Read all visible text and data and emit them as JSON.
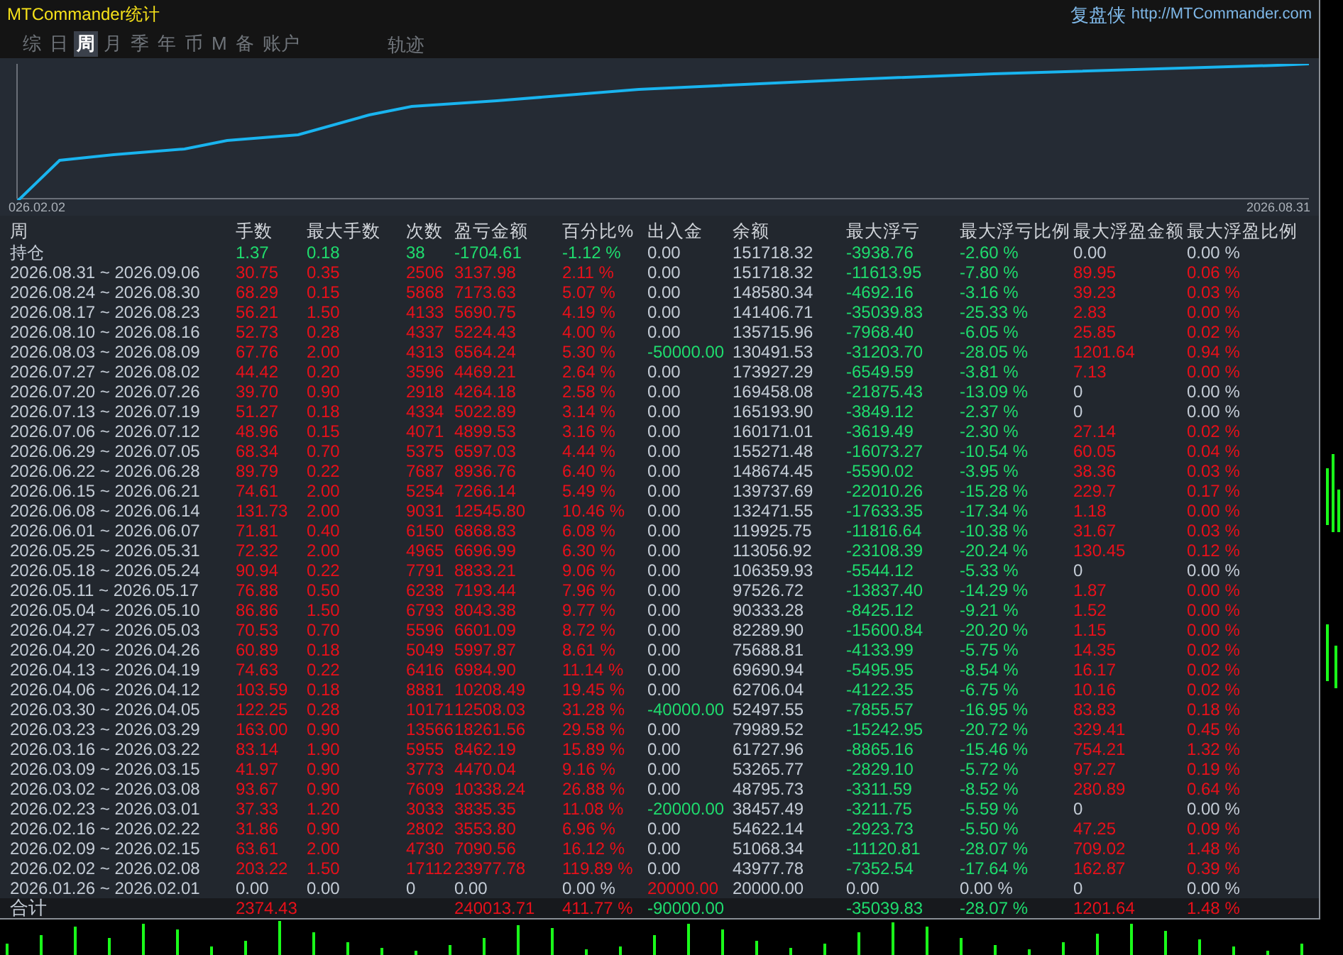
{
  "window": {
    "title": "MTCommander统计",
    "brand": "复盘侠",
    "url": "http://MTCommander.com"
  },
  "tabs": [
    {
      "label": "综",
      "selected": false
    },
    {
      "label": "日",
      "selected": false
    },
    {
      "label": "周",
      "selected": true
    },
    {
      "label": "月",
      "selected": false
    },
    {
      "label": "季",
      "selected": false
    },
    {
      "label": "年",
      "selected": false
    },
    {
      "label": "币",
      "selected": false
    },
    {
      "label": "M",
      "selected": false
    },
    {
      "label": "备",
      "selected": false
    },
    {
      "label": "账户",
      "selected": false
    }
  ],
  "trace_button": {
    "label": "轨迹"
  },
  "equity_chart": {
    "start_label": "026.02.02",
    "end_label": "2026.08.31"
  },
  "table": {
    "columns": [
      "周",
      "手数",
      "最大手数",
      "次数",
      "盈亏金额",
      "百分比%",
      "出入金",
      "余额",
      "最大浮亏",
      "最大浮亏比例",
      "最大浮盈金额",
      "最大浮盈比例"
    ],
    "rows": [
      {
        "cells": [
          {
            "text": "持仓",
            "kind": "flat"
          },
          {
            "text": "1.37",
            "kind": "down"
          },
          {
            "text": "0.18",
            "kind": "down"
          },
          {
            "text": "38",
            "kind": "down"
          },
          {
            "text": "-1704.61",
            "kind": "down"
          },
          {
            "text": "-1.12 %",
            "kind": "down"
          },
          {
            "text": "0.00",
            "kind": "flat"
          },
          {
            "text": "151718.32",
            "kind": "flat"
          },
          {
            "text": "-3938.76",
            "kind": "down"
          },
          {
            "text": "-2.60 %",
            "kind": "down"
          },
          {
            "text": "0.00",
            "kind": "flat"
          },
          {
            "text": "0.00 %",
            "kind": "flat"
          }
        ]
      },
      {
        "cells": [
          {
            "text": "2026.08.31 ~ 2026.09.06",
            "kind": "flat"
          },
          {
            "text": "30.75",
            "kind": "up"
          },
          {
            "text": "0.35",
            "kind": "up"
          },
          {
            "text": "2506",
            "kind": "up"
          },
          {
            "text": "3137.98",
            "kind": "up"
          },
          {
            "text": "2.11 %",
            "kind": "up"
          },
          {
            "text": "0.00",
            "kind": "flat"
          },
          {
            "text": "151718.32",
            "kind": "flat"
          },
          {
            "text": "-11613.95",
            "kind": "down"
          },
          {
            "text": "-7.80 %",
            "kind": "down"
          },
          {
            "text": "89.95",
            "kind": "up"
          },
          {
            "text": "0.06 %",
            "kind": "up"
          }
        ]
      },
      {
        "cells": [
          {
            "text": "2026.08.24 ~ 2026.08.30",
            "kind": "flat"
          },
          {
            "text": "68.29",
            "kind": "up"
          },
          {
            "text": "0.15",
            "kind": "up"
          },
          {
            "text": "5868",
            "kind": "up"
          },
          {
            "text": "7173.63",
            "kind": "up"
          },
          {
            "text": "5.07 %",
            "kind": "up"
          },
          {
            "text": "0.00",
            "kind": "flat"
          },
          {
            "text": "148580.34",
            "kind": "flat"
          },
          {
            "text": "-4692.16",
            "kind": "down"
          },
          {
            "text": "-3.16 %",
            "kind": "down"
          },
          {
            "text": "39.23",
            "kind": "up"
          },
          {
            "text": "0.03 %",
            "kind": "up"
          }
        ]
      },
      {
        "cells": [
          {
            "text": "2026.08.17 ~ 2026.08.23",
            "kind": "flat"
          },
          {
            "text": "56.21",
            "kind": "up"
          },
          {
            "text": "1.50",
            "kind": "up"
          },
          {
            "text": "4133",
            "kind": "up"
          },
          {
            "text": "5690.75",
            "kind": "up"
          },
          {
            "text": "4.19 %",
            "kind": "up"
          },
          {
            "text": "0.00",
            "kind": "flat"
          },
          {
            "text": "141406.71",
            "kind": "flat"
          },
          {
            "text": "-35039.83",
            "kind": "down"
          },
          {
            "text": "-25.33 %",
            "kind": "down"
          },
          {
            "text": "2.83",
            "kind": "up"
          },
          {
            "text": "0.00 %",
            "kind": "up"
          }
        ]
      },
      {
        "cells": [
          {
            "text": "2026.08.10 ~ 2026.08.16",
            "kind": "flat"
          },
          {
            "text": "52.73",
            "kind": "up"
          },
          {
            "text": "0.28",
            "kind": "up"
          },
          {
            "text": "4337",
            "kind": "up"
          },
          {
            "text": "5224.43",
            "kind": "up"
          },
          {
            "text": "4.00 %",
            "kind": "up"
          },
          {
            "text": "0.00",
            "kind": "flat"
          },
          {
            "text": "135715.96",
            "kind": "flat"
          },
          {
            "text": "-7968.40",
            "kind": "down"
          },
          {
            "text": "-6.05 %",
            "kind": "down"
          },
          {
            "text": "25.85",
            "kind": "up"
          },
          {
            "text": "0.02 %",
            "kind": "up"
          }
        ]
      },
      {
        "cells": [
          {
            "text": "2026.08.03 ~ 2026.08.09",
            "kind": "flat"
          },
          {
            "text": "67.76",
            "kind": "up"
          },
          {
            "text": "2.00",
            "kind": "up"
          },
          {
            "text": "4313",
            "kind": "up"
          },
          {
            "text": "6564.24",
            "kind": "up"
          },
          {
            "text": "5.30 %",
            "kind": "up"
          },
          {
            "text": "-50000.00",
            "kind": "down"
          },
          {
            "text": "130491.53",
            "kind": "flat"
          },
          {
            "text": "-31203.70",
            "kind": "down"
          },
          {
            "text": "-28.05 %",
            "kind": "down"
          },
          {
            "text": "1201.64",
            "kind": "up"
          },
          {
            "text": "0.94 %",
            "kind": "up"
          }
        ]
      },
      {
        "cells": [
          {
            "text": "2026.07.27 ~ 2026.08.02",
            "kind": "flat"
          },
          {
            "text": "44.42",
            "kind": "up"
          },
          {
            "text": "0.20",
            "kind": "up"
          },
          {
            "text": "3596",
            "kind": "up"
          },
          {
            "text": "4469.21",
            "kind": "up"
          },
          {
            "text": "2.64 %",
            "kind": "up"
          },
          {
            "text": "0.00",
            "kind": "flat"
          },
          {
            "text": "173927.29",
            "kind": "flat"
          },
          {
            "text": "-6549.59",
            "kind": "down"
          },
          {
            "text": "-3.81 %",
            "kind": "down"
          },
          {
            "text": "7.13",
            "kind": "up"
          },
          {
            "text": "0.00 %",
            "kind": "up"
          }
        ]
      },
      {
        "cells": [
          {
            "text": "2026.07.20 ~ 2026.07.26",
            "kind": "flat"
          },
          {
            "text": "39.70",
            "kind": "up"
          },
          {
            "text": "0.90",
            "kind": "up"
          },
          {
            "text": "2918",
            "kind": "up"
          },
          {
            "text": "4264.18",
            "kind": "up"
          },
          {
            "text": "2.58 %",
            "kind": "up"
          },
          {
            "text": "0.00",
            "kind": "flat"
          },
          {
            "text": "169458.08",
            "kind": "flat"
          },
          {
            "text": "-21875.43",
            "kind": "down"
          },
          {
            "text": "-13.09 %",
            "kind": "down"
          },
          {
            "text": "0",
            "kind": "flat"
          },
          {
            "text": "0.00 %",
            "kind": "flat"
          }
        ]
      },
      {
        "cells": [
          {
            "text": "2026.07.13 ~ 2026.07.19",
            "kind": "flat"
          },
          {
            "text": "51.27",
            "kind": "up"
          },
          {
            "text": "0.18",
            "kind": "up"
          },
          {
            "text": "4334",
            "kind": "up"
          },
          {
            "text": "5022.89",
            "kind": "up"
          },
          {
            "text": "3.14 %",
            "kind": "up"
          },
          {
            "text": "0.00",
            "kind": "flat"
          },
          {
            "text": "165193.90",
            "kind": "flat"
          },
          {
            "text": "-3849.12",
            "kind": "down"
          },
          {
            "text": "-2.37 %",
            "kind": "down"
          },
          {
            "text": "0",
            "kind": "flat"
          },
          {
            "text": "0.00 %",
            "kind": "flat"
          }
        ]
      },
      {
        "cells": [
          {
            "text": "2026.07.06 ~ 2026.07.12",
            "kind": "flat"
          },
          {
            "text": "48.96",
            "kind": "up"
          },
          {
            "text": "0.15",
            "kind": "up"
          },
          {
            "text": "4071",
            "kind": "up"
          },
          {
            "text": "4899.53",
            "kind": "up"
          },
          {
            "text": "3.16 %",
            "kind": "up"
          },
          {
            "text": "0.00",
            "kind": "flat"
          },
          {
            "text": "160171.01",
            "kind": "flat"
          },
          {
            "text": "-3619.49",
            "kind": "down"
          },
          {
            "text": "-2.30 %",
            "kind": "down"
          },
          {
            "text": "27.14",
            "kind": "up"
          },
          {
            "text": "0.02 %",
            "kind": "up"
          }
        ]
      },
      {
        "cells": [
          {
            "text": "2026.06.29 ~ 2026.07.05",
            "kind": "flat"
          },
          {
            "text": "68.34",
            "kind": "up"
          },
          {
            "text": "0.70",
            "kind": "up"
          },
          {
            "text": "5375",
            "kind": "up"
          },
          {
            "text": "6597.03",
            "kind": "up"
          },
          {
            "text": "4.44 %",
            "kind": "up"
          },
          {
            "text": "0.00",
            "kind": "flat"
          },
          {
            "text": "155271.48",
            "kind": "flat"
          },
          {
            "text": "-16073.27",
            "kind": "down"
          },
          {
            "text": "-10.54 %",
            "kind": "down"
          },
          {
            "text": "60.05",
            "kind": "up"
          },
          {
            "text": "0.04 %",
            "kind": "up"
          }
        ]
      },
      {
        "cells": [
          {
            "text": "2026.06.22 ~ 2026.06.28",
            "kind": "flat"
          },
          {
            "text": "89.79",
            "kind": "up"
          },
          {
            "text": "0.22",
            "kind": "up"
          },
          {
            "text": "7687",
            "kind": "up"
          },
          {
            "text": "8936.76",
            "kind": "up"
          },
          {
            "text": "6.40 %",
            "kind": "up"
          },
          {
            "text": "0.00",
            "kind": "flat"
          },
          {
            "text": "148674.45",
            "kind": "flat"
          },
          {
            "text": "-5590.02",
            "kind": "down"
          },
          {
            "text": "-3.95 %",
            "kind": "down"
          },
          {
            "text": "38.36",
            "kind": "up"
          },
          {
            "text": "0.03 %",
            "kind": "up"
          }
        ]
      },
      {
        "cells": [
          {
            "text": "2026.06.15 ~ 2026.06.21",
            "kind": "flat"
          },
          {
            "text": "74.61",
            "kind": "up"
          },
          {
            "text": "2.00",
            "kind": "up"
          },
          {
            "text": "5254",
            "kind": "up"
          },
          {
            "text": "7266.14",
            "kind": "up"
          },
          {
            "text": "5.49 %",
            "kind": "up"
          },
          {
            "text": "0.00",
            "kind": "flat"
          },
          {
            "text": "139737.69",
            "kind": "flat"
          },
          {
            "text": "-22010.26",
            "kind": "down"
          },
          {
            "text": "-15.28 %",
            "kind": "down"
          },
          {
            "text": "229.7",
            "kind": "up"
          },
          {
            "text": "0.17 %",
            "kind": "up"
          }
        ]
      },
      {
        "cells": [
          {
            "text": "2026.06.08 ~ 2026.06.14",
            "kind": "flat"
          },
          {
            "text": "131.73",
            "kind": "up"
          },
          {
            "text": "2.00",
            "kind": "up"
          },
          {
            "text": "9031",
            "kind": "up"
          },
          {
            "text": "12545.80",
            "kind": "up"
          },
          {
            "text": "10.46 %",
            "kind": "up"
          },
          {
            "text": "0.00",
            "kind": "flat"
          },
          {
            "text": "132471.55",
            "kind": "flat"
          },
          {
            "text": "-17633.35",
            "kind": "down"
          },
          {
            "text": "-17.34 %",
            "kind": "down"
          },
          {
            "text": "1.18",
            "kind": "up"
          },
          {
            "text": "0.00 %",
            "kind": "up"
          }
        ]
      },
      {
        "cells": [
          {
            "text": "2026.06.01 ~ 2026.06.07",
            "kind": "flat"
          },
          {
            "text": "71.81",
            "kind": "up"
          },
          {
            "text": "0.40",
            "kind": "up"
          },
          {
            "text": "6150",
            "kind": "up"
          },
          {
            "text": "6868.83",
            "kind": "up"
          },
          {
            "text": "6.08 %",
            "kind": "up"
          },
          {
            "text": "0.00",
            "kind": "flat"
          },
          {
            "text": "119925.75",
            "kind": "flat"
          },
          {
            "text": "-11816.64",
            "kind": "down"
          },
          {
            "text": "-10.38 %",
            "kind": "down"
          },
          {
            "text": "31.67",
            "kind": "up"
          },
          {
            "text": "0.03 %",
            "kind": "up"
          }
        ]
      },
      {
        "cells": [
          {
            "text": "2026.05.25 ~ 2026.05.31",
            "kind": "flat"
          },
          {
            "text": "72.32",
            "kind": "up"
          },
          {
            "text": "2.00",
            "kind": "up"
          },
          {
            "text": "4965",
            "kind": "up"
          },
          {
            "text": "6696.99",
            "kind": "up"
          },
          {
            "text": "6.30 %",
            "kind": "up"
          },
          {
            "text": "0.00",
            "kind": "flat"
          },
          {
            "text": "113056.92",
            "kind": "flat"
          },
          {
            "text": "-23108.39",
            "kind": "down"
          },
          {
            "text": "-20.24 %",
            "kind": "down"
          },
          {
            "text": "130.45",
            "kind": "up"
          },
          {
            "text": "0.12 %",
            "kind": "up"
          }
        ]
      },
      {
        "cells": [
          {
            "text": "2026.05.18 ~ 2026.05.24",
            "kind": "flat"
          },
          {
            "text": "90.94",
            "kind": "up"
          },
          {
            "text": "0.22",
            "kind": "up"
          },
          {
            "text": "7791",
            "kind": "up"
          },
          {
            "text": "8833.21",
            "kind": "up"
          },
          {
            "text": "9.06 %",
            "kind": "up"
          },
          {
            "text": "0.00",
            "kind": "flat"
          },
          {
            "text": "106359.93",
            "kind": "flat"
          },
          {
            "text": "-5544.12",
            "kind": "down"
          },
          {
            "text": "-5.33 %",
            "kind": "down"
          },
          {
            "text": "0",
            "kind": "flat"
          },
          {
            "text": "0.00 %",
            "kind": "flat"
          }
        ]
      },
      {
        "cells": [
          {
            "text": "2026.05.11 ~ 2026.05.17",
            "kind": "flat"
          },
          {
            "text": "76.88",
            "kind": "up"
          },
          {
            "text": "0.50",
            "kind": "up"
          },
          {
            "text": "6238",
            "kind": "up"
          },
          {
            "text": "7193.44",
            "kind": "up"
          },
          {
            "text": "7.96 %",
            "kind": "up"
          },
          {
            "text": "0.00",
            "kind": "flat"
          },
          {
            "text": "97526.72",
            "kind": "flat"
          },
          {
            "text": "-13837.40",
            "kind": "down"
          },
          {
            "text": "-14.29 %",
            "kind": "down"
          },
          {
            "text": "1.87",
            "kind": "up"
          },
          {
            "text": "0.00 %",
            "kind": "up"
          }
        ]
      },
      {
        "cells": [
          {
            "text": "2026.05.04 ~ 2026.05.10",
            "kind": "flat"
          },
          {
            "text": "86.86",
            "kind": "up"
          },
          {
            "text": "1.50",
            "kind": "up"
          },
          {
            "text": "6793",
            "kind": "up"
          },
          {
            "text": "8043.38",
            "kind": "up"
          },
          {
            "text": "9.77 %",
            "kind": "up"
          },
          {
            "text": "0.00",
            "kind": "flat"
          },
          {
            "text": "90333.28",
            "kind": "flat"
          },
          {
            "text": "-8425.12",
            "kind": "down"
          },
          {
            "text": "-9.21 %",
            "kind": "down"
          },
          {
            "text": "1.52",
            "kind": "up"
          },
          {
            "text": "0.00 %",
            "kind": "up"
          }
        ]
      },
      {
        "cells": [
          {
            "text": "2026.04.27 ~ 2026.05.03",
            "kind": "flat"
          },
          {
            "text": "70.53",
            "kind": "up"
          },
          {
            "text": "0.70",
            "kind": "up"
          },
          {
            "text": "5596",
            "kind": "up"
          },
          {
            "text": "6601.09",
            "kind": "up"
          },
          {
            "text": "8.72 %",
            "kind": "up"
          },
          {
            "text": "0.00",
            "kind": "flat"
          },
          {
            "text": "82289.90",
            "kind": "flat"
          },
          {
            "text": "-15600.84",
            "kind": "down"
          },
          {
            "text": "-20.20 %",
            "kind": "down"
          },
          {
            "text": "1.15",
            "kind": "up"
          },
          {
            "text": "0.00 %",
            "kind": "up"
          }
        ]
      },
      {
        "cells": [
          {
            "text": "2026.04.20 ~ 2026.04.26",
            "kind": "flat"
          },
          {
            "text": "60.89",
            "kind": "up"
          },
          {
            "text": "0.18",
            "kind": "up"
          },
          {
            "text": "5049",
            "kind": "up"
          },
          {
            "text": "5997.87",
            "kind": "up"
          },
          {
            "text": "8.61 %",
            "kind": "up"
          },
          {
            "text": "0.00",
            "kind": "flat"
          },
          {
            "text": "75688.81",
            "kind": "flat"
          },
          {
            "text": "-4133.99",
            "kind": "down"
          },
          {
            "text": "-5.75 %",
            "kind": "down"
          },
          {
            "text": "14.35",
            "kind": "up"
          },
          {
            "text": "0.02 %",
            "kind": "up"
          }
        ]
      },
      {
        "cells": [
          {
            "text": "2026.04.13 ~ 2026.04.19",
            "kind": "flat"
          },
          {
            "text": "74.63",
            "kind": "up"
          },
          {
            "text": "0.22",
            "kind": "up"
          },
          {
            "text": "6416",
            "kind": "up"
          },
          {
            "text": "6984.90",
            "kind": "up"
          },
          {
            "text": "11.14 %",
            "kind": "up"
          },
          {
            "text": "0.00",
            "kind": "flat"
          },
          {
            "text": "69690.94",
            "kind": "flat"
          },
          {
            "text": "-5495.95",
            "kind": "down"
          },
          {
            "text": "-8.54 %",
            "kind": "down"
          },
          {
            "text": "16.17",
            "kind": "up"
          },
          {
            "text": "0.02 %",
            "kind": "up"
          }
        ]
      },
      {
        "cells": [
          {
            "text": "2026.04.06 ~ 2026.04.12",
            "kind": "flat"
          },
          {
            "text": "103.59",
            "kind": "up"
          },
          {
            "text": "0.18",
            "kind": "up"
          },
          {
            "text": "8881",
            "kind": "up"
          },
          {
            "text": "10208.49",
            "kind": "up"
          },
          {
            "text": "19.45 %",
            "kind": "up"
          },
          {
            "text": "0.00",
            "kind": "flat"
          },
          {
            "text": "62706.04",
            "kind": "flat"
          },
          {
            "text": "-4122.35",
            "kind": "down"
          },
          {
            "text": "-6.75 %",
            "kind": "down"
          },
          {
            "text": "10.16",
            "kind": "up"
          },
          {
            "text": "0.02 %",
            "kind": "up"
          }
        ]
      },
      {
        "cells": [
          {
            "text": "2026.03.30 ~ 2026.04.05",
            "kind": "flat"
          },
          {
            "text": "122.25",
            "kind": "up"
          },
          {
            "text": "0.28",
            "kind": "up"
          },
          {
            "text": "10171",
            "kind": "up"
          },
          {
            "text": "12508.03",
            "kind": "up"
          },
          {
            "text": "31.28 %",
            "kind": "up"
          },
          {
            "text": "-40000.00",
            "kind": "down"
          },
          {
            "text": "52497.55",
            "kind": "flat"
          },
          {
            "text": "-7855.57",
            "kind": "down"
          },
          {
            "text": "-16.95 %",
            "kind": "down"
          },
          {
            "text": "83.83",
            "kind": "up"
          },
          {
            "text": "0.18 %",
            "kind": "up"
          }
        ]
      },
      {
        "cells": [
          {
            "text": "2026.03.23 ~ 2026.03.29",
            "kind": "flat"
          },
          {
            "text": "163.00",
            "kind": "up"
          },
          {
            "text": "0.90",
            "kind": "up"
          },
          {
            "text": "13566",
            "kind": "up"
          },
          {
            "text": "18261.56",
            "kind": "up"
          },
          {
            "text": "29.58 %",
            "kind": "up"
          },
          {
            "text": "0.00",
            "kind": "flat"
          },
          {
            "text": "79989.52",
            "kind": "flat"
          },
          {
            "text": "-15242.95",
            "kind": "down"
          },
          {
            "text": "-20.72 %",
            "kind": "down"
          },
          {
            "text": "329.41",
            "kind": "up"
          },
          {
            "text": "0.45 %",
            "kind": "up"
          }
        ]
      },
      {
        "cells": [
          {
            "text": "2026.03.16 ~ 2026.03.22",
            "kind": "flat"
          },
          {
            "text": "83.14",
            "kind": "up"
          },
          {
            "text": "1.90",
            "kind": "up"
          },
          {
            "text": "5955",
            "kind": "up"
          },
          {
            "text": "8462.19",
            "kind": "up"
          },
          {
            "text": "15.89 %",
            "kind": "up"
          },
          {
            "text": "0.00",
            "kind": "flat"
          },
          {
            "text": "61727.96",
            "kind": "flat"
          },
          {
            "text": "-8865.16",
            "kind": "down"
          },
          {
            "text": "-15.46 %",
            "kind": "down"
          },
          {
            "text": "754.21",
            "kind": "up"
          },
          {
            "text": "1.32 %",
            "kind": "up"
          }
        ]
      },
      {
        "cells": [
          {
            "text": "2026.03.09 ~ 2026.03.15",
            "kind": "flat"
          },
          {
            "text": "41.97",
            "kind": "up"
          },
          {
            "text": "0.90",
            "kind": "up"
          },
          {
            "text": "3773",
            "kind": "up"
          },
          {
            "text": "4470.04",
            "kind": "up"
          },
          {
            "text": "9.16 %",
            "kind": "up"
          },
          {
            "text": "0.00",
            "kind": "flat"
          },
          {
            "text": "53265.77",
            "kind": "flat"
          },
          {
            "text": "-2829.10",
            "kind": "down"
          },
          {
            "text": "-5.72 %",
            "kind": "down"
          },
          {
            "text": "97.27",
            "kind": "up"
          },
          {
            "text": "0.19 %",
            "kind": "up"
          }
        ]
      },
      {
        "cells": [
          {
            "text": "2026.03.02 ~ 2026.03.08",
            "kind": "flat"
          },
          {
            "text": "93.67",
            "kind": "up"
          },
          {
            "text": "0.90",
            "kind": "up"
          },
          {
            "text": "7609",
            "kind": "up"
          },
          {
            "text": "10338.24",
            "kind": "up"
          },
          {
            "text": "26.88 %",
            "kind": "up"
          },
          {
            "text": "0.00",
            "kind": "flat"
          },
          {
            "text": "48795.73",
            "kind": "flat"
          },
          {
            "text": "-3311.59",
            "kind": "down"
          },
          {
            "text": "-8.52 %",
            "kind": "down"
          },
          {
            "text": "280.89",
            "kind": "up"
          },
          {
            "text": "0.64 %",
            "kind": "up"
          }
        ]
      },
      {
        "cells": [
          {
            "text": "2026.02.23 ~ 2026.03.01",
            "kind": "flat"
          },
          {
            "text": "37.33",
            "kind": "up"
          },
          {
            "text": "1.20",
            "kind": "up"
          },
          {
            "text": "3033",
            "kind": "up"
          },
          {
            "text": "3835.35",
            "kind": "up"
          },
          {
            "text": "11.08 %",
            "kind": "up"
          },
          {
            "text": "-20000.00",
            "kind": "down"
          },
          {
            "text": "38457.49",
            "kind": "flat"
          },
          {
            "text": "-3211.75",
            "kind": "down"
          },
          {
            "text": "-5.59 %",
            "kind": "down"
          },
          {
            "text": "0",
            "kind": "flat"
          },
          {
            "text": "0.00 %",
            "kind": "flat"
          }
        ]
      },
      {
        "cells": [
          {
            "text": "2026.02.16 ~ 2026.02.22",
            "kind": "flat"
          },
          {
            "text": "31.86",
            "kind": "up"
          },
          {
            "text": "0.90",
            "kind": "up"
          },
          {
            "text": "2802",
            "kind": "up"
          },
          {
            "text": "3553.80",
            "kind": "up"
          },
          {
            "text": "6.96 %",
            "kind": "up"
          },
          {
            "text": "0.00",
            "kind": "flat"
          },
          {
            "text": "54622.14",
            "kind": "flat"
          },
          {
            "text": "-2923.73",
            "kind": "down"
          },
          {
            "text": "-5.50 %",
            "kind": "down"
          },
          {
            "text": "47.25",
            "kind": "up"
          },
          {
            "text": "0.09 %",
            "kind": "up"
          }
        ]
      },
      {
        "cells": [
          {
            "text": "2026.02.09 ~ 2026.02.15",
            "kind": "flat"
          },
          {
            "text": "63.61",
            "kind": "up"
          },
          {
            "text": "2.00",
            "kind": "up"
          },
          {
            "text": "4730",
            "kind": "up"
          },
          {
            "text": "7090.56",
            "kind": "up"
          },
          {
            "text": "16.12 %",
            "kind": "up"
          },
          {
            "text": "0.00",
            "kind": "flat"
          },
          {
            "text": "51068.34",
            "kind": "flat"
          },
          {
            "text": "-11120.81",
            "kind": "down"
          },
          {
            "text": "-28.07 %",
            "kind": "down"
          },
          {
            "text": "709.02",
            "kind": "up"
          },
          {
            "text": "1.48 %",
            "kind": "up"
          }
        ]
      },
      {
        "cells": [
          {
            "text": "2026.02.02 ~ 2026.02.08",
            "kind": "flat"
          },
          {
            "text": "203.22",
            "kind": "up"
          },
          {
            "text": "1.50",
            "kind": "up"
          },
          {
            "text": "17112",
            "kind": "up"
          },
          {
            "text": "23977.78",
            "kind": "up"
          },
          {
            "text": "119.89 %",
            "kind": "up"
          },
          {
            "text": "0.00",
            "kind": "flat"
          },
          {
            "text": "43977.78",
            "kind": "flat"
          },
          {
            "text": "-7352.54",
            "kind": "down"
          },
          {
            "text": "-17.64 %",
            "kind": "down"
          },
          {
            "text": "162.87",
            "kind": "up"
          },
          {
            "text": "0.39 %",
            "kind": "up"
          }
        ]
      },
      {
        "cells": [
          {
            "text": "2026.01.26 ~ 2026.02.01",
            "kind": "flat"
          },
          {
            "text": "0.00",
            "kind": "flat"
          },
          {
            "text": "0.00",
            "kind": "flat"
          },
          {
            "text": "0",
            "kind": "flat"
          },
          {
            "text": "0.00",
            "kind": "flat"
          },
          {
            "text": "0.00 %",
            "kind": "flat"
          },
          {
            "text": "20000.00",
            "kind": "up"
          },
          {
            "text": "20000.00",
            "kind": "flat"
          },
          {
            "text": "0.00",
            "kind": "flat"
          },
          {
            "text": "0.00 %",
            "kind": "flat"
          },
          {
            "text": "0",
            "kind": "flat"
          },
          {
            "text": "0.00 %",
            "kind": "flat"
          }
        ]
      }
    ],
    "totals": {
      "label": "合计",
      "lots": {
        "text": "2374.43",
        "kind": "up"
      },
      "profit": {
        "text": "240013.71",
        "kind": "up"
      },
      "percent": {
        "text": "411.77 %",
        "kind": "up"
      },
      "cash_flow": {
        "text": "-90000.00",
        "kind": "down"
      },
      "max_drawdown": {
        "text": "-35039.83",
        "kind": "down"
      },
      "max_drawdown_ratio": {
        "text": "-28.07 %",
        "kind": "down"
      },
      "max_gain": {
        "text": "1201.64",
        "kind": "up"
      },
      "max_gain_ratio": {
        "text": "1.48 %",
        "kind": "up"
      }
    }
  }
}
